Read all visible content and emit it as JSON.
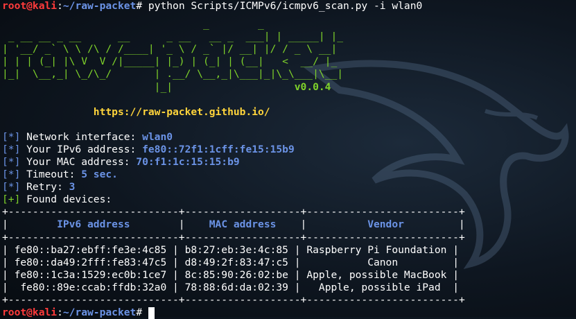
{
  "prompt": {
    "user": "root@kali",
    "sep": ":",
    "path": "~/raw-packet",
    "symbol": "#"
  },
  "command": " python Scripts/ICMPv6/icmpv6_scan.py -i wlan0",
  "banner": [
    "                                 _        _      ",
    " _ __ __ _ __      __      _ __   __ _  ___| | _____| |_ ",
    "| '__/ _` \\ \\ /\\ / /____| '_ \\ / _` |/ __| |/ / _ \\ __|",
    "| | | (_| |\\ V  V /|_____| |_) | (_| | (__|   <  __/ |_ ",
    "|_|  \\__,_| \\_/\\_/       | .__/ \\__,_|\\___|_|\\_\\___|\\__|",
    "                         |_|                    "
  ],
  "version": "v0.0.4",
  "url": "https://raw-packet.github.io/",
  "info": [
    {
      "tag": "[*]",
      "label": " Network interface: ",
      "value": "wlan0"
    },
    {
      "tag": "[*]",
      "label": " Your IPv6 address: ",
      "value": "fe80::72f1:1cff:fe15:15b9"
    },
    {
      "tag": "[*]",
      "label": " Your MAC address: ",
      "value": "70:f1:1c:15:15:b9"
    },
    {
      "tag": "[*]",
      "label": " Timeout: ",
      "value": "5 sec."
    },
    {
      "tag": "[*]",
      "label": " Retry: ",
      "value": "3"
    },
    {
      "tag": "[+]",
      "label": " Found devices:",
      "value": ""
    }
  ],
  "table": {
    "border": "+----------------------------+-------------------+-------------------------+",
    "headers": [
      "IPv6 address",
      "MAC address",
      "Vendor"
    ],
    "rows": [
      [
        "fe80::ba27:ebff:fe3e:4c85",
        "b8:27:eb:3e:4c:85",
        "Raspberry Pi Foundation"
      ],
      [
        "fe80::da49:2fff:fe83:47c5",
        "d8:49:2f:83:47:c5",
        "Canon"
      ],
      [
        "fe80::1c3a:1529:ec0b:1ce7",
        "8c:85:90:26:02:be",
        "Apple, possible MacBook"
      ],
      [
        "fe80::89e:ccab:ffdb:32a0",
        "78:88:6d:da:02:39",
        "Apple, possible iPad"
      ]
    ]
  },
  "colors": {
    "red": "#ff3b3b",
    "blue": "#6b93e6",
    "green": "#7fd32a",
    "yellow": "#ffd43b"
  }
}
